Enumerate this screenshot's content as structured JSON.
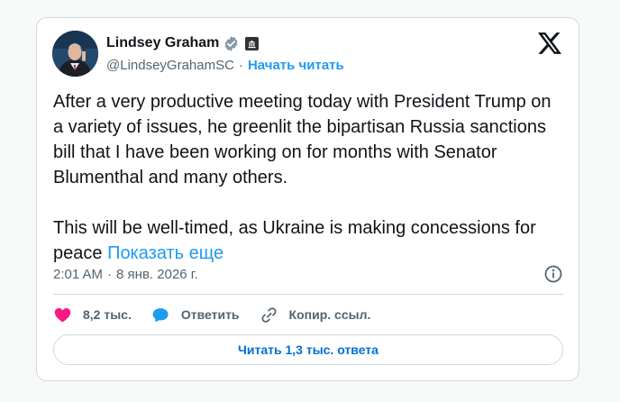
{
  "author": {
    "name": "Lindsey Graham",
    "handle": "@LindseyGrahamSC",
    "separator": "·",
    "follow_label": "Начать читать"
  },
  "tweet": {
    "text": "After a very productive meeting today with President Trump on a variety of issues, he greenlit the bipartisan Russia sanctions bill that I have been working on for months with Senator Blumenthal and many others.\n\nThis will be well-timed, as Ukraine is making concessions for peace ",
    "show_more_label": "Показать еще"
  },
  "meta": {
    "time": "2:01 AM",
    "separator": "·",
    "date": "8 янв. 2026 г."
  },
  "actions": {
    "likes": "8,2 тыс.",
    "reply_label": "Ответить",
    "copy_link_label": "Копир. ссыл."
  },
  "read_replies_label": "Читать 1,3 тыс. ответа",
  "colors": {
    "accent": "#1d9bf0",
    "like": "#f91880",
    "text": "#0f1419",
    "muted": "#536471"
  },
  "icons": [
    "verified-badge-icon",
    "government-affiliation-icon",
    "x-logo-icon",
    "info-icon",
    "heart-icon",
    "reply-bubble-icon",
    "link-icon"
  ]
}
